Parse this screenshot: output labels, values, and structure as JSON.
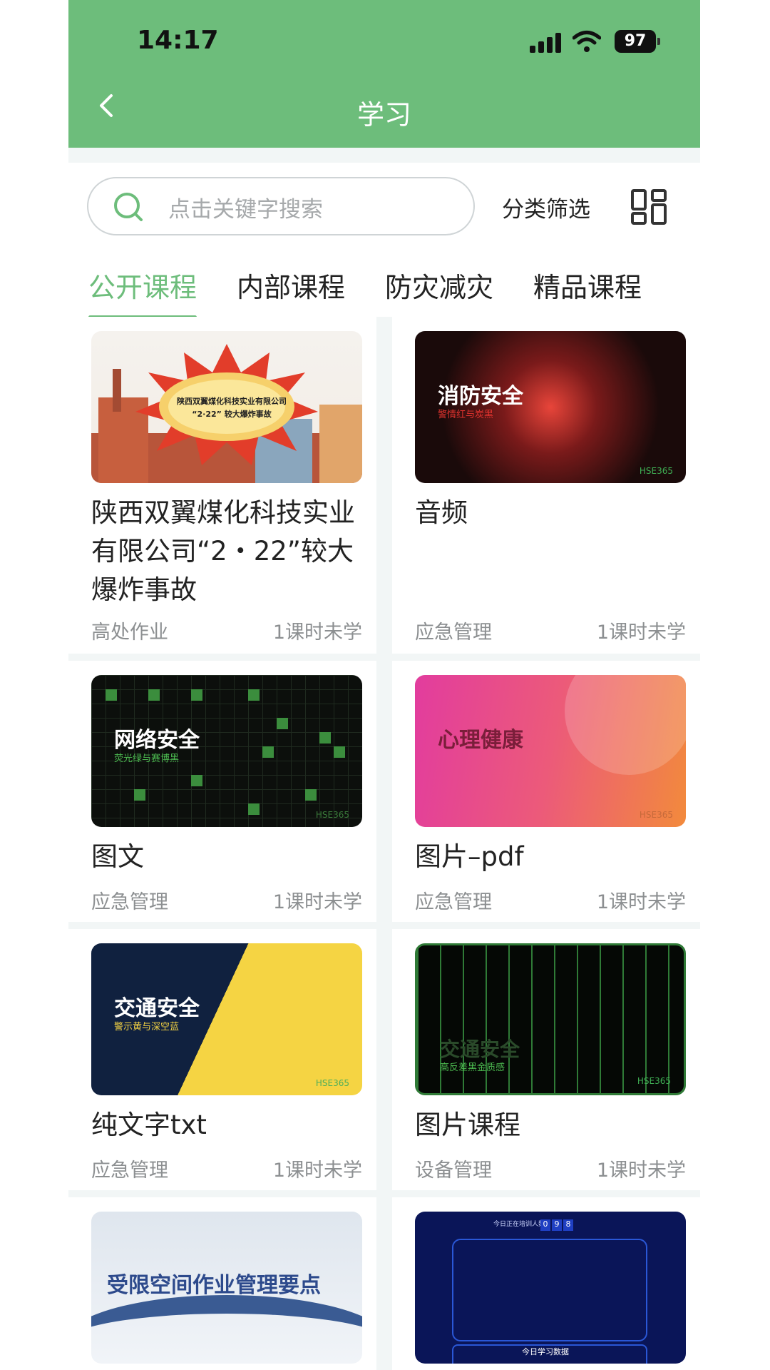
{
  "status": {
    "time": "14:17",
    "battery": "97"
  },
  "header": {
    "title": "学习"
  },
  "search": {
    "placeholder": "点击关键字搜索",
    "filter_label": "分类筛选"
  },
  "tabs": [
    "公开课程",
    "内部课程",
    "防灾减灾",
    "精品课程"
  ],
  "colors": {
    "brand": "#6dbd7b"
  },
  "courses": [
    {
      "title": "陕西双翼煤化科技实业有限公司“2・22”较大爆炸事故",
      "category": "高处作业",
      "status": "1课时未学",
      "thumb_text": "陕西双翼煤化科技实业有限公司",
      "thumb_sub": "“2·22” 较大爆炸事故"
    },
    {
      "title": "音频",
      "category": "应急管理",
      "status": "1课时未学",
      "thumb_text": "消防安全",
      "thumb_sub": "警情红与炭黑",
      "thumb_watermark": "HSE365"
    },
    {
      "title": "图文",
      "category": "应急管理",
      "status": "1课时未学",
      "thumb_text": "网络安全",
      "thumb_sub": "荧光绿与赛博黑",
      "thumb_watermark": "HSE365"
    },
    {
      "title": "图片–pdf",
      "category": "应急管理",
      "status": "1课时未学",
      "thumb_text": "心理健康",
      "thumb_watermark": "HSE365"
    },
    {
      "title": "纯文字txt",
      "category": "应急管理",
      "status": "1课时未学",
      "thumb_text": "交通安全",
      "thumb_sub": "警示黄与深空蓝",
      "thumb_watermark": "HSE365"
    },
    {
      "title": "图片课程",
      "category": "设备管理",
      "status": "1课时未学",
      "thumb_text": "交通安全",
      "thumb_sub": "高反差黑金质感",
      "thumb_watermark": "HSE365"
    },
    {
      "thumb_text": "受限空间作业管理要点"
    },
    {
      "thumb_text": "今日学习数据",
      "thumb_sub": "今日正在培训人数",
      "thumb_digits": [
        "0",
        "9",
        "8"
      ]
    }
  ]
}
